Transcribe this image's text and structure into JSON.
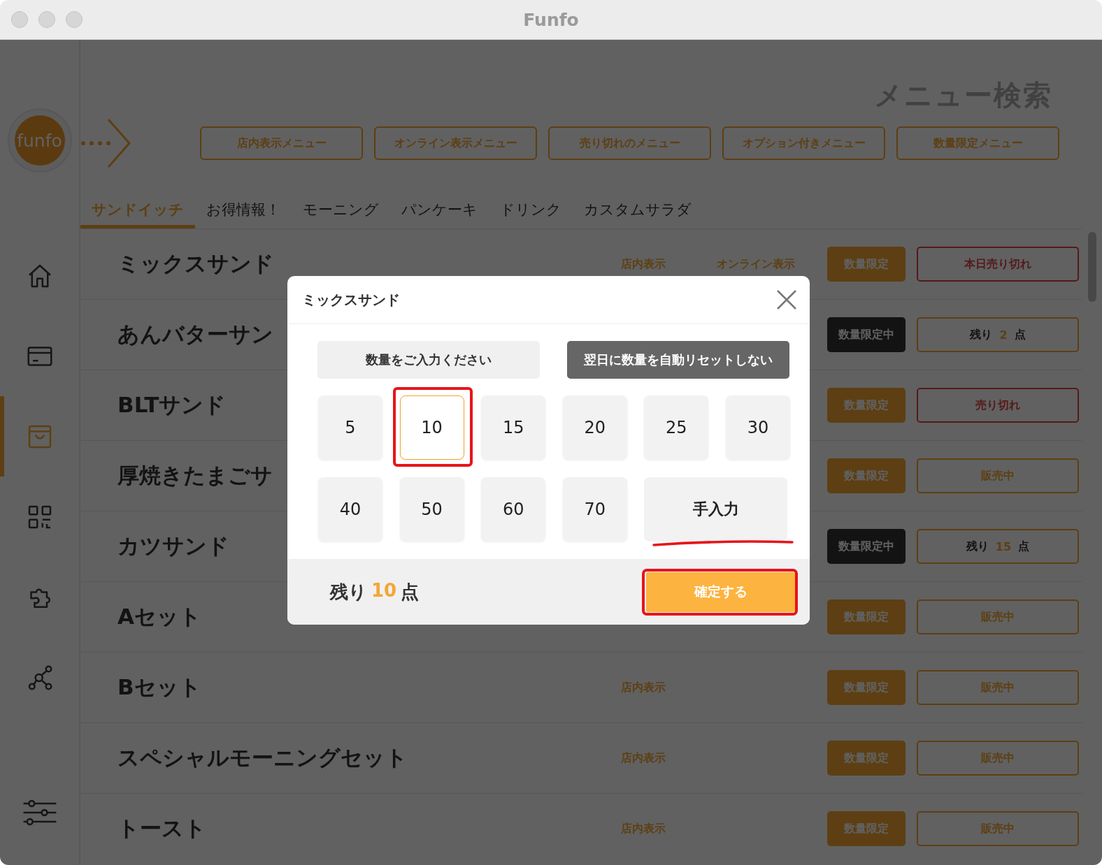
{
  "window": {
    "title": "Funfo"
  },
  "sidebar": {
    "logo": "funfo",
    "items": [
      {
        "kind": "home",
        "selected": false
      },
      {
        "kind": "card",
        "selected": false
      },
      {
        "kind": "bag",
        "selected": true
      },
      {
        "kind": "qr",
        "selected": false
      },
      {
        "kind": "puzzle",
        "selected": false
      },
      {
        "kind": "network",
        "selected": false
      }
    ],
    "bottom_item": {
      "kind": "sliders"
    }
  },
  "header": {
    "title": "メニュー検索",
    "filters": [
      "店内表示メニュー",
      "オンライン表示メニュー",
      "売り切れのメニュー",
      "オプション付きメニュー",
      "数量限定メニュー"
    ]
  },
  "tabs": [
    {
      "label": "サンドイッチ",
      "selected": true
    },
    {
      "label": "お得情報！",
      "selected": false
    },
    {
      "label": "モーニング",
      "selected": false
    },
    {
      "label": "パンケーキ",
      "selected": false
    },
    {
      "label": "ドリンク",
      "selected": false
    },
    {
      "label": "カスタムサラダ",
      "selected": false
    }
  ],
  "rows": [
    {
      "name": "ミックスサンド",
      "in_store": "店内表示",
      "online": "オンライン表示",
      "badge": {
        "label": "数量限定",
        "active": false
      },
      "status": {
        "kind": "sold_out",
        "label": "本日売り切れ"
      }
    },
    {
      "name": "あんバターサン",
      "badge": {
        "label": "数量限定中",
        "active": true
      },
      "status": {
        "kind": "remaining",
        "prefix": "残り",
        "count": "2",
        "suffix": "点"
      }
    },
    {
      "name": "BLTサンド",
      "badge": {
        "label": "数量限定",
        "active": false
      },
      "status": {
        "kind": "sold_out",
        "label": "売り切れ"
      }
    },
    {
      "name": "厚焼きたまごサ",
      "badge": {
        "label": "数量限定",
        "active": false
      },
      "status": {
        "kind": "on_sale",
        "label": "販売中"
      }
    },
    {
      "name": "カツサンド",
      "badge": {
        "label": "数量限定中",
        "active": true
      },
      "status": {
        "kind": "remaining",
        "prefix": "残り",
        "count": "15",
        "suffix": "点"
      }
    },
    {
      "name": "Aセット",
      "badge": {
        "label": "数量限定",
        "active": false
      },
      "status": {
        "kind": "on_sale",
        "label": "販売中"
      }
    },
    {
      "name": "Bセット",
      "in_store": "店内表示",
      "badge": {
        "label": "数量限定",
        "active": false
      },
      "status": {
        "kind": "on_sale",
        "label": "販売中"
      }
    },
    {
      "name": "スペシャルモーニングセット",
      "in_store": "店内表示",
      "badge": {
        "label": "数量限定",
        "active": false
      },
      "status": {
        "kind": "on_sale",
        "label": "販売中"
      }
    },
    {
      "name": "トースト",
      "in_store": "店内表示",
      "badge": {
        "label": "数量限定",
        "active": false
      },
      "status": {
        "kind": "on_sale",
        "label": "販売中"
      }
    }
  ],
  "modal": {
    "title": "ミックスサンド",
    "input_button": "数量をご入力ください",
    "reset_button": "翌日に数量を自動リセットしない",
    "presets": [
      {
        "label": "5",
        "selected": false,
        "annotated": false
      },
      {
        "label": "10",
        "selected": true,
        "annotated": true
      },
      {
        "label": "15",
        "selected": false,
        "annotated": false
      },
      {
        "label": "20",
        "selected": false,
        "annotated": false
      },
      {
        "label": "25",
        "selected": false,
        "annotated": false
      },
      {
        "label": "30",
        "selected": false,
        "annotated": false
      },
      {
        "label": "40",
        "selected": false,
        "annotated": false
      },
      {
        "label": "50",
        "selected": false,
        "annotated": false
      },
      {
        "label": "60",
        "selected": false,
        "annotated": false
      },
      {
        "label": "70",
        "selected": false,
        "annotated": false
      }
    ],
    "manual_button": {
      "label": "手入力",
      "annotated": true
    },
    "remaining": {
      "prefix": "残り",
      "count": "10",
      "suffix": "点"
    },
    "confirm_button": {
      "label": "確定する",
      "annotated": true
    }
  }
}
